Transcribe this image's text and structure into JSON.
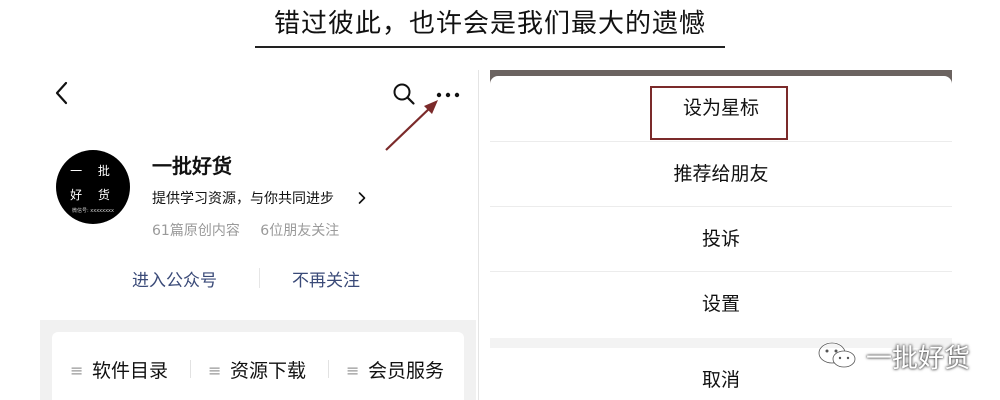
{
  "headline": "错过彼此，也许会是我们最大的遗憾",
  "profile": {
    "avatar_line1": "一 批",
    "avatar_line2": "好 货",
    "avatar_line3": "微信号: xxxxxxxx",
    "name": "一批好货",
    "description": "提供学习资源，与你共同进步",
    "original_count": "61篇原创内容",
    "friends_follow": "6位朋友关注"
  },
  "actions": {
    "enter_account": "进入公众号",
    "unfollow": "不再关注"
  },
  "bottom_menu": {
    "items": [
      {
        "label": "软件目录"
      },
      {
        "label": "资源下载"
      },
      {
        "label": "会员服务"
      }
    ]
  },
  "action_sheet": {
    "set_star": "设为星标",
    "recommend": "推荐给朋友",
    "complain": "投诉",
    "settings": "设置",
    "cancel": "取消"
  },
  "watermark": {
    "text": "一批好货"
  },
  "colors": {
    "highlight_border": "#7b2a2a",
    "arrow": "#7b2a2a",
    "link_blue": "#3a4a78"
  },
  "icons": [
    "back-icon",
    "search-icon",
    "more-icon",
    "chevron-right-icon",
    "menu-icon",
    "wechat-icon"
  ]
}
